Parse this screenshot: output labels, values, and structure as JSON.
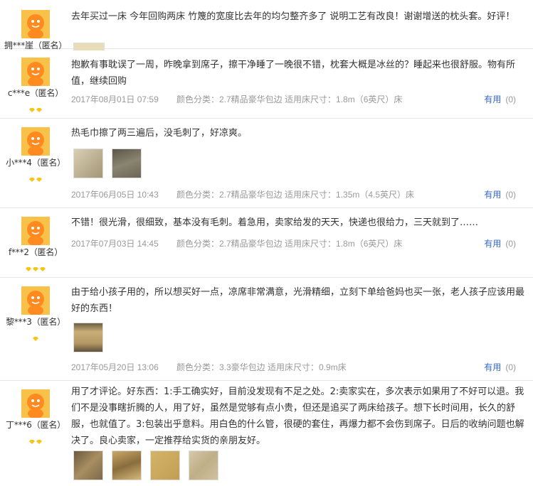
{
  "reviews": [
    {
      "user": "拥***崖（匿名）",
      "text": "去年买过一床 今年回购两床 竹篾的宽度比去年的均匀整齐多了 说明工艺有改良！谢谢增送的枕头套。好评！",
      "badges": 0
    },
    {
      "user": "c***e（匿名）",
      "text": "抱歉有事耽误了一周，昨晚拿到席子，擦干净睡了一晚很不错，枕套大概是冰丝的？睡起来也很舒服。物有所值，继续回购",
      "date": "2017年08月01日 07:59",
      "sku": "颜色分类：2.7精品豪华包边  适用床尺寸：1.8m（6英尺）床",
      "helpful_label": "有用",
      "helpful_count": "(0)",
      "badges": 2
    },
    {
      "user": "小***4（匿名）",
      "text": "热毛巾擦了两三遍后，没毛刺了，好凉爽。",
      "date": "2017年06月05日 10:43",
      "sku": "颜色分类：2.7精品豪华包边  适用床尺寸：1.35m（4.5英尺）床",
      "helpful_label": "有用",
      "helpful_count": "(0)",
      "badges": 2
    },
    {
      "user": "f***2（匿名）",
      "text": "不错！很光滑，很细致，基本没有毛刺。着急用，卖家给发的天天，快递也很给力，三天就到了……",
      "date": "2017年07月03日 14:45",
      "sku": "颜色分类：2.7精品豪华包边  适用床尺寸：1.8m（6英尺）床",
      "helpful_label": "有用",
      "helpful_count": "(0)",
      "badges": 3
    },
    {
      "user": "黎***3（匿名）",
      "text": "由于给小孩子用的，所以想买好一点，凉席非常满意，光滑精细，立刻下单给爸妈也买一张，老人孩子应该用最好的东西！",
      "date": "2017年05月20日 13:06",
      "sku": "颜色分类：3.3豪华包边  适用床尺寸：0.9m床",
      "helpful_label": "有用",
      "helpful_count": "(0)",
      "badges": 1
    },
    {
      "user": "丁***6（匿名）",
      "text": "用了才评论。好东西：1:手工确实好，目前没发现有不足之处。2:卖家实在，多次表示如果用了不好可以退。我们不是没事瞎折腾的人，用了好，虽然是觉够有点小贵，但还是追买了两床给孩子。想下长时间用，长久的舒服，也就值了。3:包装出乎意料。用白色的什么管，很硬的套住，再爆力都不会伤到席子。日后的收纳问题也解决了。良心卖家，一定推荐给实货的亲朋友好。",
      "badges": 2
    }
  ],
  "colors": {
    "link": "#3366cc",
    "meta": "#999999",
    "badge": "#f5c518",
    "divider": "#e6e6e6"
  }
}
